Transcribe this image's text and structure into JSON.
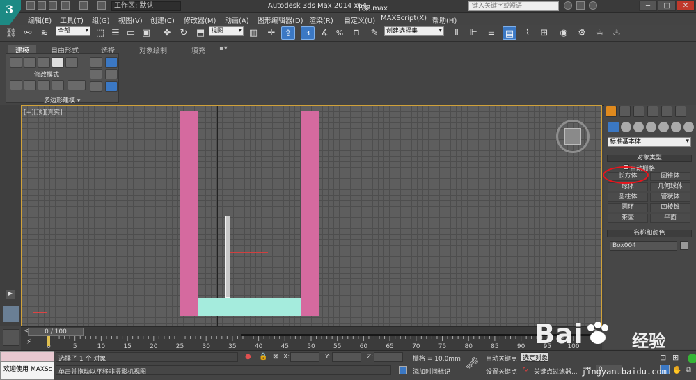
{
  "titlebar": {
    "workspace_label": "工作区: 默认",
    "app_title": "Autodesk 3ds Max  2014 x64",
    "file_name": "书架.max",
    "search_placeholder": "键入关键字或短语",
    "minimize": "─",
    "maximize": "□",
    "close": "✕"
  },
  "menubar": {
    "items": [
      "编辑(E)",
      "工具(T)",
      "组(G)",
      "视图(V)",
      "创建(C)",
      "修改器(M)",
      "动画(A)",
      "图形编辑器(D)",
      "渲染(R)",
      "自定义(U)",
      "MAXScript(X)",
      "帮助(H)"
    ]
  },
  "toolbar": {
    "selection_filter": "全部",
    "ref_coord": "视图",
    "snap_value": "3",
    "percent_snap": "%",
    "named_selection": "创建选择集"
  },
  "ribbon": {
    "tabs": [
      "建模",
      "自由形式",
      "选择",
      "对象绘制",
      "填充"
    ],
    "panel_label": "修改模式",
    "poly_label": "多边形建模 ▾"
  },
  "viewport": {
    "label": "[+][顶][真实]",
    "colors": {
      "pink": "#d56a9f",
      "cyan": "#a5ecdd",
      "border": "#d1a23a"
    }
  },
  "command_panel": {
    "dropdown": "标准基本体",
    "object_type_header": "对象类型",
    "autogrid_label": "自动栅格",
    "buttons": [
      "长方体",
      "圆锥体",
      "球体",
      "几何球体",
      "圆柱体",
      "管状体",
      "圆环",
      "四棱锥",
      "茶壶",
      "平面"
    ],
    "name_color_header": "名称和颜色",
    "object_name": "Box004"
  },
  "timeline": {
    "frame_display": "0 / 100",
    "ticks": [
      "0",
      "5",
      "10",
      "15",
      "20",
      "25",
      "30",
      "35",
      "40",
      "45",
      "50",
      "55",
      "60",
      "65",
      "70",
      "75",
      "80",
      "85",
      "90",
      "95",
      "100"
    ]
  },
  "statusbar": {
    "welcome": "欢迎使用 MAXSc",
    "selection_info": "选择了 1 个 对象",
    "prompt": "单击并拖动以平移非摄影机视图",
    "x_label": "X:",
    "y_label": "Y:",
    "z_label": "Z:",
    "grid": "栅格 = 10.0mm",
    "add_time_tag": "添加时间标记",
    "auto_key": "自动关键点",
    "set_key": "设置关键点",
    "selected_label": "选定对象",
    "key_filters": "关键点过滤器...",
    "frame_field": "0"
  },
  "watermark": {
    "brand": "Bai",
    "brand2": "du",
    "product": "经验",
    "domain": "jingyan.baidu.com"
  }
}
